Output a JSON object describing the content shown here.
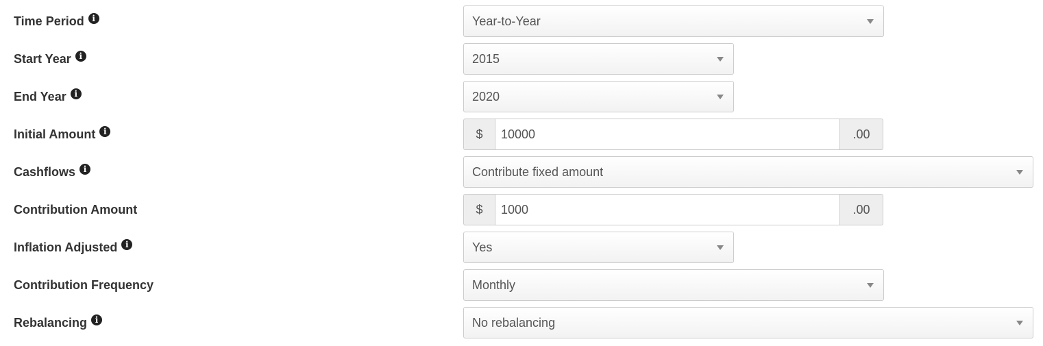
{
  "fields": [
    {
      "label": "Time Period",
      "info_icon": "info-circle-icon",
      "control": "select",
      "value": "Year-to-Year"
    },
    {
      "label": "Start Year",
      "info_icon": "info-circle-icon",
      "control": "select",
      "value": "2015"
    },
    {
      "label": "End Year",
      "info_icon": "info-circle-icon",
      "control": "select",
      "value": "2020"
    },
    {
      "label": "Initial Amount",
      "info_icon": "info-circle-icon",
      "control": "currency",
      "prefix": "$",
      "value": "10000",
      "suffix": ".00"
    },
    {
      "label": "Cashflows",
      "info_icon": "info-circle-icon",
      "control": "select",
      "value": "Contribute fixed amount"
    },
    {
      "label": "Contribution Amount",
      "control": "currency",
      "prefix": "$",
      "value": "1000",
      "suffix": ".00"
    },
    {
      "label": "Inflation Adjusted",
      "info_icon": "info-circle-icon",
      "control": "select",
      "value": "Yes"
    },
    {
      "label": "Contribution Frequency",
      "control": "select",
      "value": "Monthly"
    },
    {
      "label": "Rebalancing",
      "info_icon": "info-circle-icon",
      "control": "select",
      "value": "No rebalancing"
    }
  ],
  "info_glyph": "i"
}
